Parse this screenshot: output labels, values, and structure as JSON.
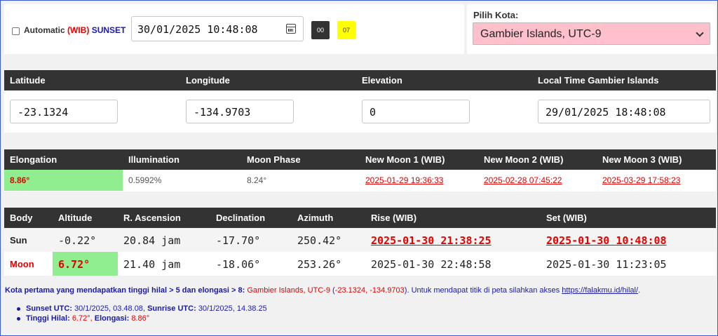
{
  "controls": {
    "automatic_label": "Automatic",
    "wib_label": "(WIB)",
    "sunset_label": "SUNSET",
    "datetime_value": "30/01/2025 10:48:08",
    "hour_button": "00",
    "minute_button": "07",
    "city_label": "Pilih Kota:",
    "city_value": "Gambier Islands, UTC-9"
  },
  "location": {
    "headers": [
      "Latitude",
      "Longitude",
      "Elevation",
      "Local Time Gambier Islands"
    ],
    "values": [
      "-23.1324",
      "-134.9703",
      "0",
      "29/01/2025 18:48:08"
    ]
  },
  "moon": {
    "headers": [
      "Elongation",
      "Illumination",
      "Moon Phase",
      "New Moon 1",
      "New Moon 2",
      "New Moon 3"
    ],
    "wib": "(WIB)",
    "values": [
      "8.86°",
      "0.5992%",
      "8.24°",
      "2025-01-29 19:36:33",
      "2025-02-28 07:45:22",
      "2025-03-29 17:58:23"
    ]
  },
  "bodies": {
    "headers": [
      "Body",
      "Altitude",
      "R. Ascension",
      "Declination",
      "Azimuth",
      "Rise",
      "Set"
    ],
    "wib": "(WIB)",
    "rows": [
      {
        "name": "Sun",
        "altitude": "-0.22°",
        "ra": "20.84 jam",
        "dec": "-17.70°",
        "azimuth": "250.42°",
        "rise": "2025-01-30 21:38:25",
        "set": "2025-01-30 10:48:08"
      },
      {
        "name": "Moon",
        "altitude": "6.72°",
        "ra": "21.40 jam",
        "dec": "-18.06°",
        "azimuth": "253.26°",
        "rise": "2025-01-30 22:48:58",
        "set": "2025-01-30 11:23:05"
      }
    ]
  },
  "footer": {
    "intro": "Kota pertama yang mendapatkan tinggi hilal > 5 dan elongasi > 8:",
    "city": "Gambier Islands, UTC-9",
    "coords": "(-23.1324, -134.9703)",
    "tail": ". Untuk mendapat titik di peta silahkan akses",
    "link": "https://falakmu.id/hilal/",
    "end": ".",
    "sunset_utc_label": "Sunset UTC:",
    "sunset_utc_value": "30/1/2025, 03.48.08,",
    "sunrise_utc_label": "Sunrise UTC:",
    "sunrise_utc_value": "30/1/2025, 14.38.25",
    "tinggi_label": "Tinggi Hilal:",
    "tinggi_value": "6.72°,",
    "elongasi_label": "Elongasi:",
    "elongasi_value": "8.86°"
  }
}
